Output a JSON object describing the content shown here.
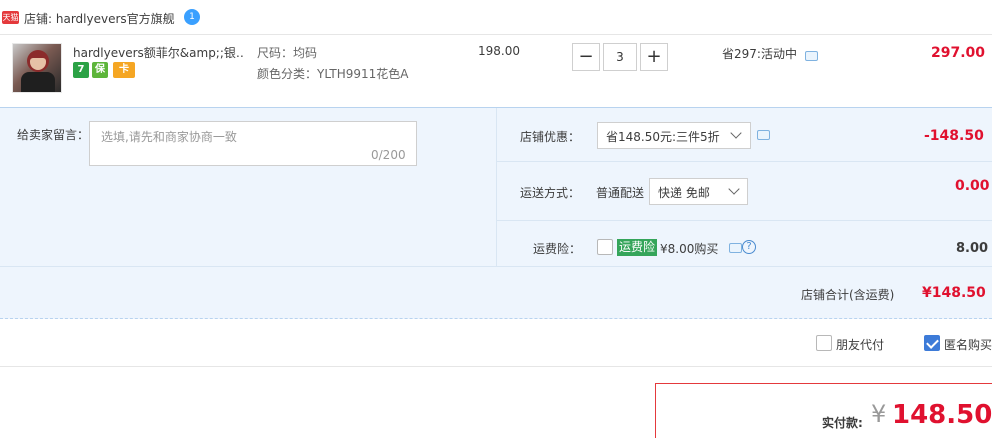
{
  "shop": {
    "badge": "天猫",
    "name": "店铺: hardlyevers官方旗舰",
    "wangwang_icon": "wangwang-icon"
  },
  "item": {
    "title": "hardlyevers额菲尔&amp;;银…",
    "badges": [
      "7",
      "保",
      "卡"
    ],
    "sku_size": "尺码：均码",
    "sku_color": "颜色分类：YLTH9911花色A",
    "unit_price": "198.00",
    "quantity": "3",
    "qty_minus": "−",
    "qty_plus": "+",
    "promo": "省297:活动中",
    "subtotal": "297.00"
  },
  "memo": {
    "label": "给卖家留言：",
    "placeholder": "选填,请先和商家协商一致",
    "count": "0/200"
  },
  "discount": {
    "label": "店铺优惠：",
    "selected": "省148.50元:三件5折",
    "amount": "-148.50"
  },
  "shipping": {
    "label": "运送方式：",
    "type": "普通配送",
    "selected": "快递 免邮",
    "amount": "0.00"
  },
  "insurance": {
    "label": "运费险：",
    "tag": "运费险",
    "price": "¥8.00购买",
    "amount": "8.00",
    "help": "?"
  },
  "shop_total": {
    "label": "店铺合计(含运费)",
    "amount": "¥148.50"
  },
  "options": {
    "friend_pay": "朋友代付",
    "anonymous": "匿名购买"
  },
  "payment": {
    "label": "实付款:",
    "currency": "¥",
    "amount": "148.50"
  },
  "colors": {
    "accent_red": "#e0112f",
    "panel_blue": "#eef5fd",
    "check_blue": "#3d7bd8",
    "insurance_green": "#35a55a"
  }
}
